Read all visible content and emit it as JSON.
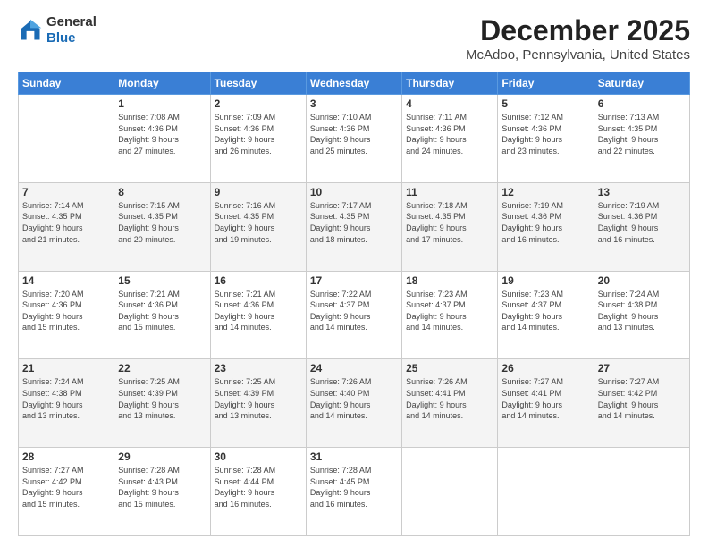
{
  "logo": {
    "line1": "General",
    "line2": "Blue"
  },
  "title": "December 2025",
  "subtitle": "McAdoo, Pennsylvania, United States",
  "days_header": [
    "Sunday",
    "Monday",
    "Tuesday",
    "Wednesday",
    "Thursday",
    "Friday",
    "Saturday"
  ],
  "weeks": [
    {
      "shaded": false,
      "days": [
        {
          "num": "",
          "info": ""
        },
        {
          "num": "1",
          "info": "Sunrise: 7:08 AM\nSunset: 4:36 PM\nDaylight: 9 hours\nand 27 minutes."
        },
        {
          "num": "2",
          "info": "Sunrise: 7:09 AM\nSunset: 4:36 PM\nDaylight: 9 hours\nand 26 minutes."
        },
        {
          "num": "3",
          "info": "Sunrise: 7:10 AM\nSunset: 4:36 PM\nDaylight: 9 hours\nand 25 minutes."
        },
        {
          "num": "4",
          "info": "Sunrise: 7:11 AM\nSunset: 4:36 PM\nDaylight: 9 hours\nand 24 minutes."
        },
        {
          "num": "5",
          "info": "Sunrise: 7:12 AM\nSunset: 4:36 PM\nDaylight: 9 hours\nand 23 minutes."
        },
        {
          "num": "6",
          "info": "Sunrise: 7:13 AM\nSunset: 4:35 PM\nDaylight: 9 hours\nand 22 minutes."
        }
      ]
    },
    {
      "shaded": true,
      "days": [
        {
          "num": "7",
          "info": "Sunrise: 7:14 AM\nSunset: 4:35 PM\nDaylight: 9 hours\nand 21 minutes."
        },
        {
          "num": "8",
          "info": "Sunrise: 7:15 AM\nSunset: 4:35 PM\nDaylight: 9 hours\nand 20 minutes."
        },
        {
          "num": "9",
          "info": "Sunrise: 7:16 AM\nSunset: 4:35 PM\nDaylight: 9 hours\nand 19 minutes."
        },
        {
          "num": "10",
          "info": "Sunrise: 7:17 AM\nSunset: 4:35 PM\nDaylight: 9 hours\nand 18 minutes."
        },
        {
          "num": "11",
          "info": "Sunrise: 7:18 AM\nSunset: 4:35 PM\nDaylight: 9 hours\nand 17 minutes."
        },
        {
          "num": "12",
          "info": "Sunrise: 7:19 AM\nSunset: 4:36 PM\nDaylight: 9 hours\nand 16 minutes."
        },
        {
          "num": "13",
          "info": "Sunrise: 7:19 AM\nSunset: 4:36 PM\nDaylight: 9 hours\nand 16 minutes."
        }
      ]
    },
    {
      "shaded": false,
      "days": [
        {
          "num": "14",
          "info": "Sunrise: 7:20 AM\nSunset: 4:36 PM\nDaylight: 9 hours\nand 15 minutes."
        },
        {
          "num": "15",
          "info": "Sunrise: 7:21 AM\nSunset: 4:36 PM\nDaylight: 9 hours\nand 15 minutes."
        },
        {
          "num": "16",
          "info": "Sunrise: 7:21 AM\nSunset: 4:36 PM\nDaylight: 9 hours\nand 14 minutes."
        },
        {
          "num": "17",
          "info": "Sunrise: 7:22 AM\nSunset: 4:37 PM\nDaylight: 9 hours\nand 14 minutes."
        },
        {
          "num": "18",
          "info": "Sunrise: 7:23 AM\nSunset: 4:37 PM\nDaylight: 9 hours\nand 14 minutes."
        },
        {
          "num": "19",
          "info": "Sunrise: 7:23 AM\nSunset: 4:37 PM\nDaylight: 9 hours\nand 14 minutes."
        },
        {
          "num": "20",
          "info": "Sunrise: 7:24 AM\nSunset: 4:38 PM\nDaylight: 9 hours\nand 13 minutes."
        }
      ]
    },
    {
      "shaded": true,
      "days": [
        {
          "num": "21",
          "info": "Sunrise: 7:24 AM\nSunset: 4:38 PM\nDaylight: 9 hours\nand 13 minutes."
        },
        {
          "num": "22",
          "info": "Sunrise: 7:25 AM\nSunset: 4:39 PM\nDaylight: 9 hours\nand 13 minutes."
        },
        {
          "num": "23",
          "info": "Sunrise: 7:25 AM\nSunset: 4:39 PM\nDaylight: 9 hours\nand 13 minutes."
        },
        {
          "num": "24",
          "info": "Sunrise: 7:26 AM\nSunset: 4:40 PM\nDaylight: 9 hours\nand 14 minutes."
        },
        {
          "num": "25",
          "info": "Sunrise: 7:26 AM\nSunset: 4:41 PM\nDaylight: 9 hours\nand 14 minutes."
        },
        {
          "num": "26",
          "info": "Sunrise: 7:27 AM\nSunset: 4:41 PM\nDaylight: 9 hours\nand 14 minutes."
        },
        {
          "num": "27",
          "info": "Sunrise: 7:27 AM\nSunset: 4:42 PM\nDaylight: 9 hours\nand 14 minutes."
        }
      ]
    },
    {
      "shaded": false,
      "days": [
        {
          "num": "28",
          "info": "Sunrise: 7:27 AM\nSunset: 4:42 PM\nDaylight: 9 hours\nand 15 minutes."
        },
        {
          "num": "29",
          "info": "Sunrise: 7:28 AM\nSunset: 4:43 PM\nDaylight: 9 hours\nand 15 minutes."
        },
        {
          "num": "30",
          "info": "Sunrise: 7:28 AM\nSunset: 4:44 PM\nDaylight: 9 hours\nand 16 minutes."
        },
        {
          "num": "31",
          "info": "Sunrise: 7:28 AM\nSunset: 4:45 PM\nDaylight: 9 hours\nand 16 minutes."
        },
        {
          "num": "",
          "info": ""
        },
        {
          "num": "",
          "info": ""
        },
        {
          "num": "",
          "info": ""
        }
      ]
    }
  ]
}
